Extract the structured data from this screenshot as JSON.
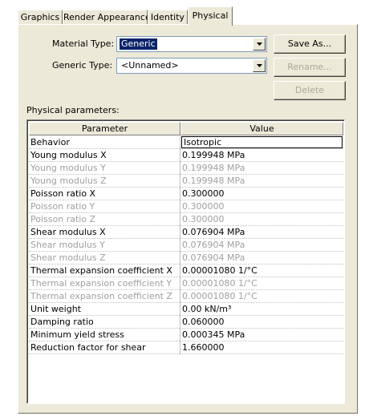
{
  "tabs": [
    {
      "label": "Graphics"
    },
    {
      "label": "Render Appearance"
    },
    {
      "label": "Identity"
    },
    {
      "label": "Physical"
    }
  ],
  "form": {
    "material_type_label": "Material Type:",
    "material_type_value": "Generic",
    "generic_type_label": "Generic Type:",
    "generic_type_value": "<Unnamed>"
  },
  "buttons": {
    "save_as": "Save As...",
    "rename": "Rename...",
    "delete": "Delete"
  },
  "grid": {
    "section_label": "Physical parameters:",
    "headers": [
      "Parameter",
      "Value"
    ],
    "rows": [
      {
        "name": "Behavior",
        "value": "Isotropic",
        "enabled": true
      },
      {
        "name": "Young modulus X",
        "value": "0.199948 MPa",
        "enabled": true
      },
      {
        "name": "Young modulus Y",
        "value": "0.199948 MPa",
        "enabled": false
      },
      {
        "name": "Young modulus Z",
        "value": "0.199948 MPa",
        "enabled": false
      },
      {
        "name": "Poisson ratio X",
        "value": "0.300000",
        "enabled": true
      },
      {
        "name": "Poisson ratio Y",
        "value": "0.300000",
        "enabled": false
      },
      {
        "name": "Poisson ratio Z",
        "value": "0.300000",
        "enabled": false
      },
      {
        "name": "Shear modulus X",
        "value": "0.076904 MPa",
        "enabled": true
      },
      {
        "name": "Shear modulus Y",
        "value": "0.076904 MPa",
        "enabled": false
      },
      {
        "name": "Shear modulus Z",
        "value": "0.076904 MPa",
        "enabled": false
      },
      {
        "name": "Thermal expansion coefficient X",
        "value": "0.00001080 1/°C",
        "enabled": true
      },
      {
        "name": "Thermal expansion coefficient Y",
        "value": "0.00001080 1/°C",
        "enabled": false
      },
      {
        "name": "Thermal expansion coefficient Z",
        "value": "0.00001080 1/°C",
        "enabled": false
      },
      {
        "name": "Unit weight",
        "value": "0.00 kN/m³",
        "enabled": true
      },
      {
        "name": "Damping ratio",
        "value": "0.060000",
        "enabled": true
      },
      {
        "name": "Minimum yield stress",
        "value": "0.000345 MPa",
        "enabled": true
      },
      {
        "name": "Reduction factor for shear",
        "value": "1.660000",
        "enabled": true
      }
    ]
  }
}
